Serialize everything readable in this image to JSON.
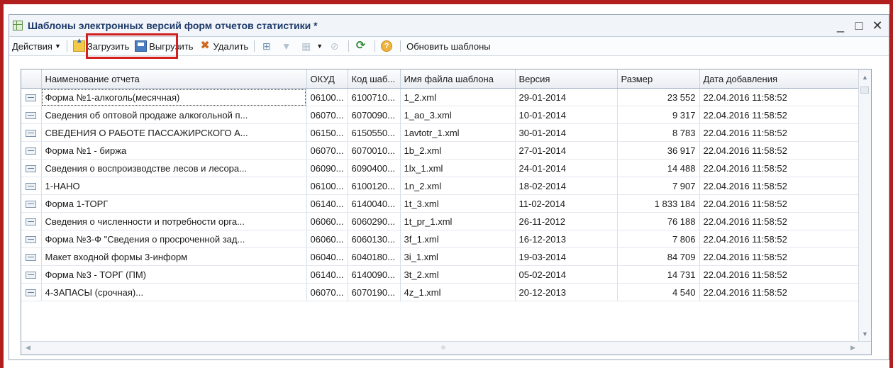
{
  "window": {
    "title": "Шаблоны электронных версий форм отчетов статистики *",
    "minimize": "_",
    "maximize": "□",
    "close": "✕"
  },
  "toolbar": {
    "actions": "Действия",
    "load": "Загрузить",
    "unload": "Выгрузить",
    "delete": "Удалить",
    "help": "?",
    "refresh_templates": "Обновить шаблоны"
  },
  "table": {
    "columns": [
      "",
      "Наименование отчета",
      "ОКУД",
      "Код шаб...",
      "Имя файла шаблона",
      "Версия",
      "Размер",
      "Дата добавления"
    ],
    "rows": [
      {
        "name": "Форма №1-алкоголь(месячная)",
        "okud": "06100...",
        "code": "6100710...",
        "file": "1_2.xml",
        "version": "29-01-2014",
        "size": "23 552",
        "date": "22.04.2016 11:58:52"
      },
      {
        "name": "Сведения об оптовой продаже алкогольной п...",
        "okud": "06070...",
        "code": "6070090...",
        "file": "1_ao_3.xml",
        "version": "10-01-2014",
        "size": "9 317",
        "date": "22.04.2016 11:58:52"
      },
      {
        "name": "СВЕДЕНИЯ О РАБОТЕ ПАССАЖИРСКОГО А...",
        "okud": "06150...",
        "code": "6150550...",
        "file": "1avtotr_1.xml",
        "version": "30-01-2014",
        "size": "8 783",
        "date": "22.04.2016 11:58:52"
      },
      {
        "name": "Форма №1 - биржа",
        "okud": "06070...",
        "code": "6070010...",
        "file": "1b_2.xml",
        "version": "27-01-2014",
        "size": "36 917",
        "date": "22.04.2016 11:58:52"
      },
      {
        "name": "Сведения о воспроизводстве лесов и лесора...",
        "okud": "06090...",
        "code": "6090400...",
        "file": "1lx_1.xml",
        "version": "24-01-2014",
        "size": "14 488",
        "date": "22.04.2016 11:58:52"
      },
      {
        "name": "1-НАНО",
        "okud": "06100...",
        "code": "6100120...",
        "file": "1n_2.xml",
        "version": "18-02-2014",
        "size": "7 907",
        "date": "22.04.2016 11:58:52"
      },
      {
        "name": "Форма 1-ТОРГ",
        "okud": "06140...",
        "code": "6140040...",
        "file": "1t_3.xml",
        "version": "11-02-2014",
        "size": "1 833 184",
        "date": "22.04.2016 11:58:52"
      },
      {
        "name": "Сведения о численности и потребности орга...",
        "okud": "06060...",
        "code": "6060290...",
        "file": "1t_pr_1.xml",
        "version": "26-11-2012",
        "size": "76 188",
        "date": "22.04.2016 11:58:52"
      },
      {
        "name": "Форма №3-Ф \"Сведения о просроченной зад...",
        "okud": "06060...",
        "code": "6060130...",
        "file": "3f_1.xml",
        "version": "16-12-2013",
        "size": "7 806",
        "date": "22.04.2016 11:58:52"
      },
      {
        "name": "Макет входной формы  3-информ",
        "okud": "06040...",
        "code": "6040180...",
        "file": "3i_1.xml",
        "version": "19-03-2014",
        "size": "84 709",
        "date": "22.04.2016 11:58:52"
      },
      {
        "name": "Форма №3 - ТОРГ (ПМ)",
        "okud": "06140...",
        "code": "6140090...",
        "file": "3t_2.xml",
        "version": "05-02-2014",
        "size": "14 731",
        "date": "22.04.2016 11:58:52"
      },
      {
        "name": "4-ЗАПАСЫ (срочная)...",
        "okud": "06070...",
        "code": "6070190...",
        "file": "4z_1.xml",
        "version": "20-12-2013",
        "size": "4 540",
        "date": "22.04.2016 11:58:52"
      }
    ]
  }
}
